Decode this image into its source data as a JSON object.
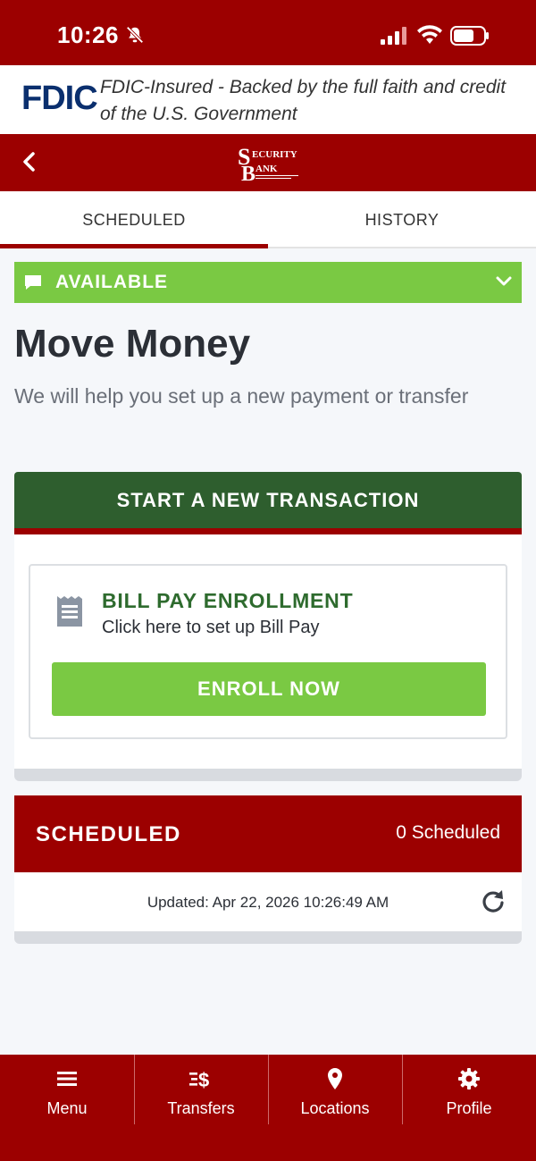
{
  "status_bar": {
    "time": "10:26"
  },
  "fdic": {
    "logo_text": "FDIC",
    "tagline": "FDIC-Insured - Backed by the full faith and credit of the U.S. Government"
  },
  "header": {
    "logo_lines": [
      "SECURITY",
      "BANK"
    ]
  },
  "tabs": [
    {
      "label": "SCHEDULED",
      "active": true
    },
    {
      "label": "HISTORY",
      "active": false
    }
  ],
  "availability": {
    "label": "AVAILABLE",
    "color": "#7ac943"
  },
  "main": {
    "title": "Move Money",
    "subtitle": "We will help you set up a new payment or transfer",
    "start_button": "START A NEW TRANSACTION"
  },
  "bill_pay": {
    "title": "BILL PAY ENROLLMENT",
    "subtitle": "Click here to set up Bill Pay",
    "button": "ENROLL NOW"
  },
  "scheduled": {
    "title": "SCHEDULED",
    "count": "0 Scheduled",
    "updated": "Updated: Apr 22, 2026 10:26:49 AM"
  },
  "bottom_nav": [
    {
      "label": "Menu",
      "icon": "menu-icon"
    },
    {
      "label": "Transfers",
      "icon": "transfers-icon"
    },
    {
      "label": "Locations",
      "icon": "location-pin-icon"
    },
    {
      "label": "Profile",
      "icon": "gear-icon"
    }
  ],
  "colors": {
    "brand_red": "#9c0000",
    "dark_green": "#2e5e2e",
    "light_green": "#7ac943"
  }
}
